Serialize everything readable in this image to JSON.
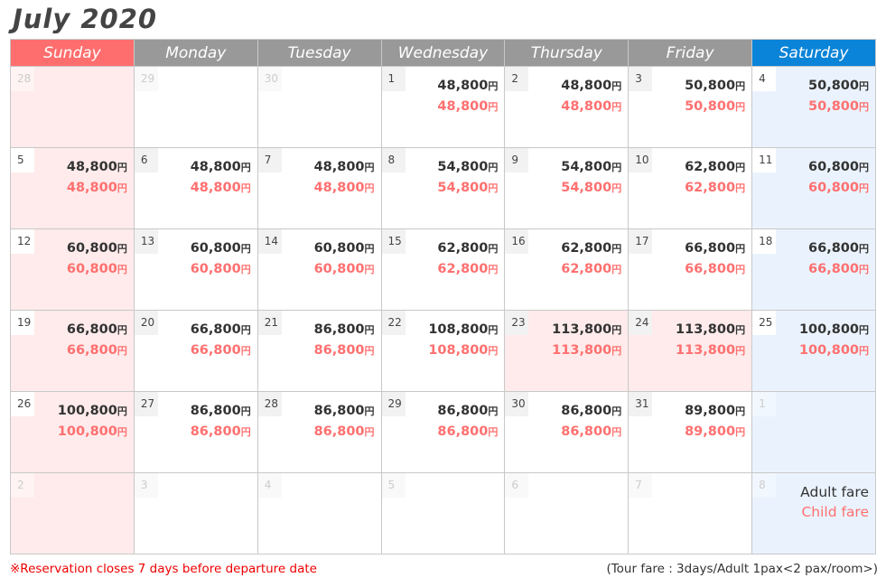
{
  "title": "July 2020",
  "currency_symbol": "円",
  "colors": {
    "sunday_header": "#ff6e6e",
    "weekday_header": "#999999",
    "saturday_header": "#0a84d8",
    "sunday_bg": "#ffebeb",
    "saturday_bg": "#eaf3fd",
    "child_fare": "#ff7070",
    "notice": "#ee0000"
  },
  "weekdays": [
    "Sunday",
    "Monday",
    "Tuesday",
    "Wednesday",
    "Thursday",
    "Friday",
    "Saturday"
  ],
  "weeks": [
    [
      {
        "day": "28",
        "out": true
      },
      {
        "day": "29",
        "out": true
      },
      {
        "day": "30",
        "out": true
      },
      {
        "day": "1",
        "adult": "48,800",
        "child": "48,800"
      },
      {
        "day": "2",
        "adult": "48,800",
        "child": "48,800"
      },
      {
        "day": "3",
        "adult": "50,800",
        "child": "50,800"
      },
      {
        "day": "4",
        "adult": "50,800",
        "child": "50,800"
      }
    ],
    [
      {
        "day": "5",
        "adult": "48,800",
        "child": "48,800"
      },
      {
        "day": "6",
        "adult": "48,800",
        "child": "48,800"
      },
      {
        "day": "7",
        "adult": "48,800",
        "child": "48,800"
      },
      {
        "day": "8",
        "adult": "54,800",
        "child": "54,800"
      },
      {
        "day": "9",
        "adult": "54,800",
        "child": "54,800"
      },
      {
        "day": "10",
        "adult": "62,800",
        "child": "62,800"
      },
      {
        "day": "11",
        "adult": "60,800",
        "child": "60,800"
      }
    ],
    [
      {
        "day": "12",
        "adult": "60,800",
        "child": "60,800"
      },
      {
        "day": "13",
        "adult": "60,800",
        "child": "60,800"
      },
      {
        "day": "14",
        "adult": "60,800",
        "child": "60,800"
      },
      {
        "day": "15",
        "adult": "62,800",
        "child": "62,800"
      },
      {
        "day": "16",
        "adult": "62,800",
        "child": "62,800"
      },
      {
        "day": "17",
        "adult": "66,800",
        "child": "66,800"
      },
      {
        "day": "18",
        "adult": "66,800",
        "child": "66,800"
      }
    ],
    [
      {
        "day": "19",
        "adult": "66,800",
        "child": "66,800"
      },
      {
        "day": "20",
        "adult": "66,800",
        "child": "66,800"
      },
      {
        "day": "21",
        "adult": "86,800",
        "child": "86,800"
      },
      {
        "day": "22",
        "adult": "108,800",
        "child": "108,800"
      },
      {
        "day": "23",
        "adult": "113,800",
        "child": "113,800",
        "holiday": true
      },
      {
        "day": "24",
        "adult": "113,800",
        "child": "113,800",
        "holiday": true
      },
      {
        "day": "25",
        "adult": "100,800",
        "child": "100,800"
      }
    ],
    [
      {
        "day": "26",
        "adult": "100,800",
        "child": "100,800"
      },
      {
        "day": "27",
        "adult": "86,800",
        "child": "86,800"
      },
      {
        "day": "28",
        "adult": "86,800",
        "child": "86,800"
      },
      {
        "day": "29",
        "adult": "86,800",
        "child": "86,800"
      },
      {
        "day": "30",
        "adult": "86,800",
        "child": "86,800"
      },
      {
        "day": "31",
        "adult": "89,800",
        "child": "89,800"
      },
      {
        "day": "1",
        "out": true
      }
    ],
    [
      {
        "day": "2",
        "out": true
      },
      {
        "day": "3",
        "out": true
      },
      {
        "day": "4",
        "out": true
      },
      {
        "day": "5",
        "out": true
      },
      {
        "day": "6",
        "out": true
      },
      {
        "day": "7",
        "out": true
      },
      {
        "day": "8",
        "out": true,
        "legend": true
      }
    ]
  ],
  "legend": {
    "adult_label": "Adult fare",
    "child_label": "Child fare"
  },
  "footer": {
    "notice": "※Reservation closes 7 days before departure date",
    "tour_info": "(Tour fare : 3days/Adult 1pax<2 pax/room>)"
  }
}
